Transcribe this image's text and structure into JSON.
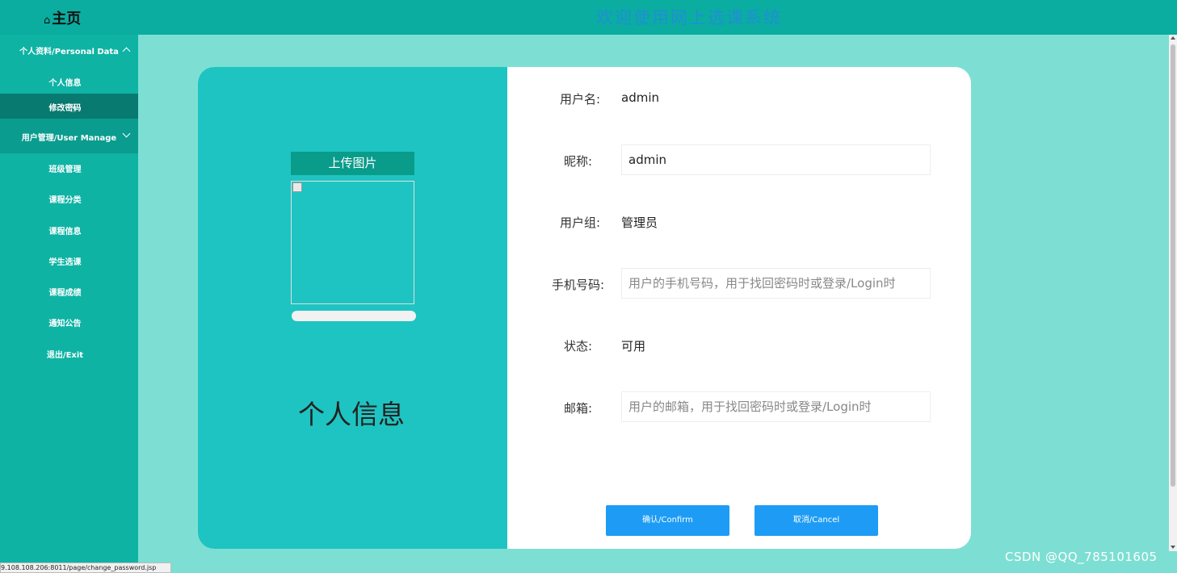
{
  "header": {
    "home_icon": "house-icon",
    "home_label": "主页",
    "welcome": "欢迎使用网上选课系统"
  },
  "sidebar": {
    "groups": [
      {
        "label": "个人资料/Personal Data",
        "expanded": true,
        "items": [
          "个人信息",
          "修改密码"
        ]
      },
      {
        "label": "用户管理/User Manage",
        "expanded": false
      }
    ],
    "items": [
      "班级管理",
      "课程分类",
      "课程信息",
      "学生选课",
      "课程成绩",
      "通知公告",
      "退出/Exit"
    ]
  },
  "card": {
    "upload_label": "上传图片",
    "title": "个人信息"
  },
  "form": {
    "username_label": "用户名:",
    "username_value": "admin",
    "nickname_label": "昵称:",
    "nickname_value": "admin",
    "group_label": "用户组:",
    "group_value": "管理员",
    "phone_label": "手机号码:",
    "phone_placeholder": "用户的手机号码，用于找回密码时或登录/Login时",
    "state_label": "状态:",
    "state_value": "可用",
    "email_label": "邮箱:",
    "email_placeholder": "用户的邮箱，用于找回密码时或登录/Login时",
    "confirm_label": "确认/Confirm",
    "cancel_label": "取消/Cancel"
  },
  "status_url": "9.108.108.206:8011/page/change_password.jsp",
  "watermark": "CSDN @QQ_785101605",
  "colors": {
    "topbar": "#0aada0",
    "sidebar": "#0fb3a4",
    "background": "#7ddfd3",
    "card_left": "#1ec4c1",
    "button": "#1e9cf5",
    "welcome_text": "#1f8fd6"
  }
}
